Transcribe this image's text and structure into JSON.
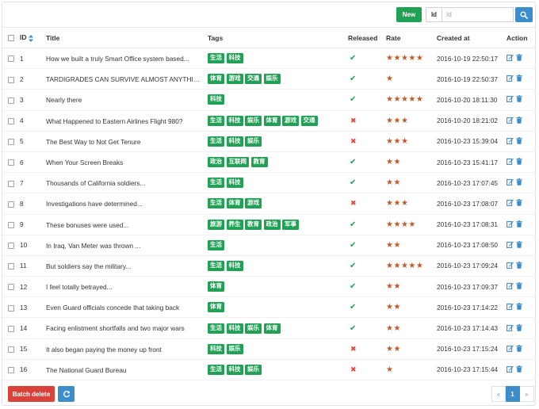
{
  "toolbar": {
    "new_label": "New",
    "search_addon": "Id",
    "search_placeholder": "Id",
    "search_value": ""
  },
  "columns": {
    "id": "ID",
    "title": "Title",
    "tags": "Tags",
    "released": "Released",
    "rate": "Rate",
    "created_at": "Created at",
    "action": "Action"
  },
  "rows": [
    {
      "id": "1",
      "title": "How we built a truly Smart Office system based...",
      "tags": [
        "生活",
        "科技"
      ],
      "released": true,
      "rate": 5,
      "created_at": "2016-10-19 22:50:17"
    },
    {
      "id": "2",
      "title": "TARDIGRADES CAN SURVIVE ALMOST ANYTHING",
      "tags": [
        "体育",
        "游戏",
        "交通",
        "娱乐"
      ],
      "released": true,
      "rate": 1,
      "created_at": "2016-10-19 22:50:37"
    },
    {
      "id": "3",
      "title": "Nearly there",
      "tags": [
        "科技"
      ],
      "released": true,
      "rate": 5,
      "created_at": "2016-10-20 18:11:30"
    },
    {
      "id": "4",
      "title": "What Happened to Eastern Airlines Flight 980?",
      "tags": [
        "生活",
        "科技",
        "娱乐",
        "体育",
        "游戏",
        "交通"
      ],
      "released": false,
      "rate": 3,
      "created_at": "2016-10-20 18:21:02"
    },
    {
      "id": "5",
      "title": "The Best Way to Not Get Tenure",
      "tags": [
        "生活",
        "科技",
        "娱乐"
      ],
      "released": false,
      "rate": 3,
      "created_at": "2016-10-23 15:39:04"
    },
    {
      "id": "6",
      "title": "When Your Screen Breaks",
      "tags": [
        "政治",
        "互联网",
        "教育"
      ],
      "released": true,
      "rate": 2,
      "created_at": "2016-10-23 15:41:17"
    },
    {
      "id": "7",
      "title": "Thousands of California soldiers...",
      "tags": [
        "生活",
        "科技"
      ],
      "released": true,
      "rate": 2,
      "created_at": "2016-10-23 17:07:45"
    },
    {
      "id": "8",
      "title": "Investigations have determined...",
      "tags": [
        "生活",
        "体育",
        "游戏"
      ],
      "released": false,
      "rate": 3,
      "created_at": "2016-10-23 17:08:07"
    },
    {
      "id": "9",
      "title": "These bonuses were used...",
      "tags": [
        "旅游",
        "养生",
        "教育",
        "政治",
        "军事"
      ],
      "released": true,
      "rate": 4,
      "created_at": "2016-10-23 17:08:31"
    },
    {
      "id": "10",
      "title": "In Iraq, Van Meter was thrown ...",
      "tags": [
        "生活"
      ],
      "released": true,
      "rate": 2,
      "created_at": "2016-10-23 17:08:50"
    },
    {
      "id": "11",
      "title": "But soldiers say the military...",
      "tags": [
        "生活",
        "科技"
      ],
      "released": true,
      "rate": 5,
      "created_at": "2016-10-23 17:09:24"
    },
    {
      "id": "12",
      "title": "I feel totally betrayed...",
      "tags": [
        "体育"
      ],
      "released": true,
      "rate": 2,
      "created_at": "2016-10-23 17:09:37"
    },
    {
      "id": "13",
      "title": "Even Guard officials concede that taking back",
      "tags": [
        "体育"
      ],
      "released": true,
      "rate": 2,
      "created_at": "2016-10-23 17:14:22"
    },
    {
      "id": "14",
      "title": "Facing enlistment shortfalls and two major wars",
      "tags": [
        "生活",
        "科技",
        "娱乐",
        "体育"
      ],
      "released": true,
      "rate": 2,
      "created_at": "2016-10-23 17:14:43"
    },
    {
      "id": "15",
      "title": "It also began paying the money up front",
      "tags": [
        "科技",
        "娱乐"
      ],
      "released": false,
      "rate": 2,
      "created_at": "2016-10-23 17:15:24"
    },
    {
      "id": "16",
      "title": "The National Guard Bureau",
      "tags": [
        "生活",
        "科技",
        "娱乐"
      ],
      "released": false,
      "rate": 1,
      "created_at": "2016-10-23 17:15:44"
    }
  ],
  "footer": {
    "batch_delete_label": "Batch delete",
    "pagination": {
      "prev": "«",
      "current": "1",
      "next": "»"
    }
  },
  "colors": {
    "tag": "#21a155",
    "released": "#21a155",
    "not_released": "#e0463c",
    "star": "#c05a28",
    "primary": "#3c8dcb",
    "danger": "#d9423a"
  },
  "icons": {
    "search_button": "search-icon",
    "sort": "sort-icon",
    "edit": "edit-icon",
    "delete": "trash-icon",
    "refresh": "refresh-icon",
    "released_true": "check-icon",
    "released_false": "cross-icon"
  }
}
